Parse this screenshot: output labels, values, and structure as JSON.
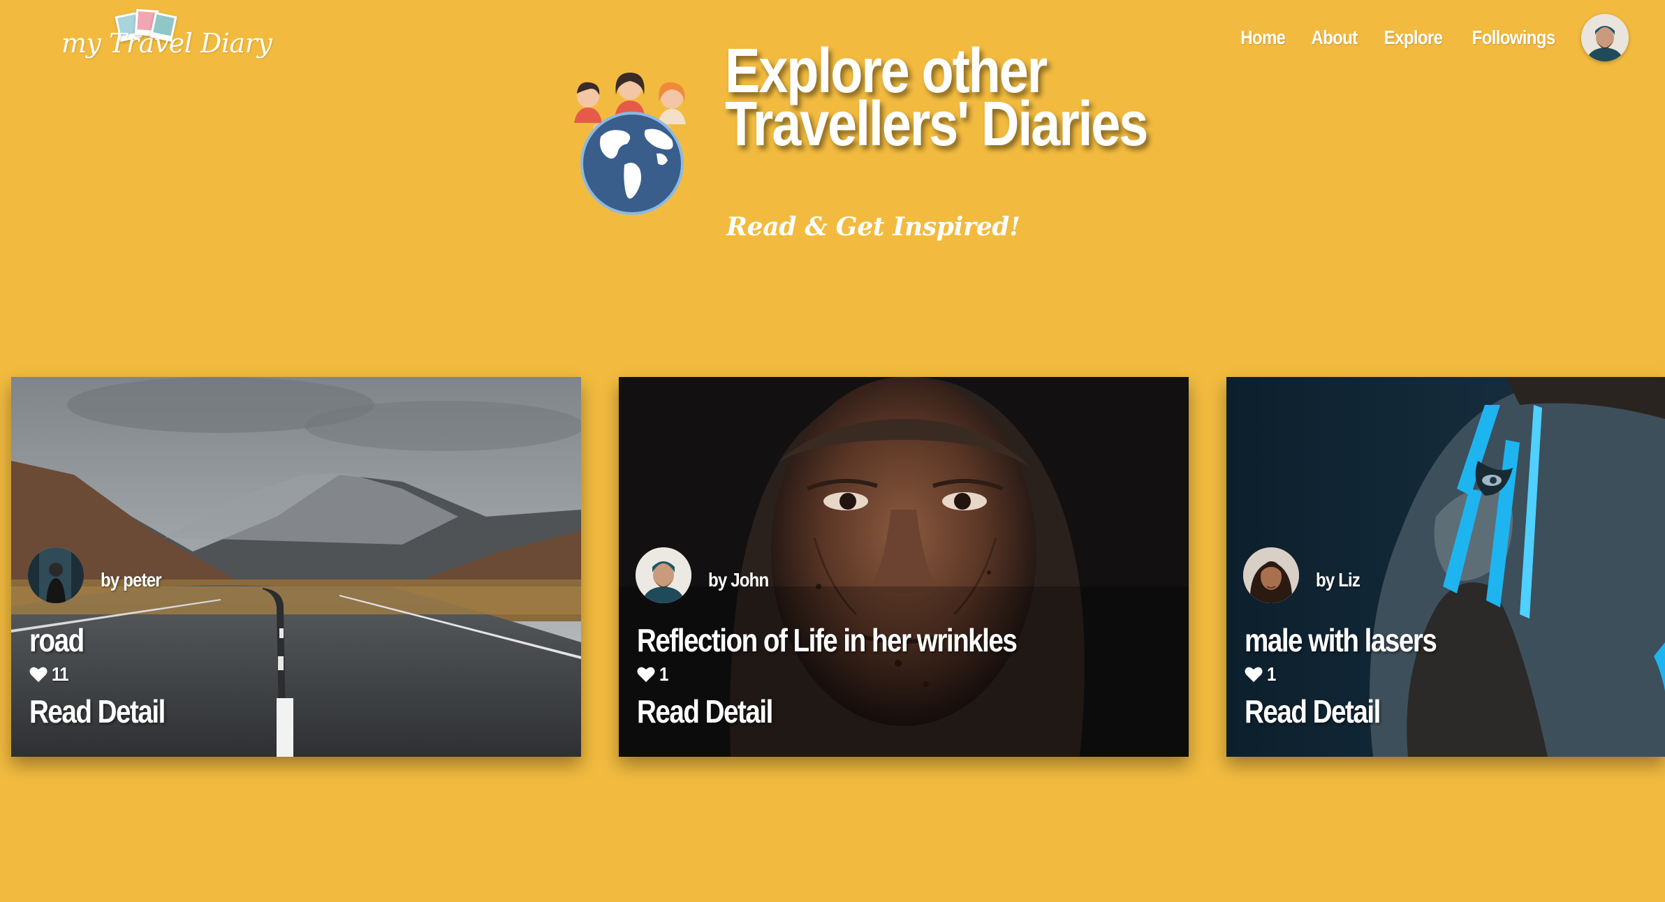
{
  "brand": {
    "logo_text": "my Travel Diary"
  },
  "nav": {
    "items": [
      {
        "label": "Home"
      },
      {
        "label": "About"
      },
      {
        "label": "Explore"
      },
      {
        "label": "Followings"
      }
    ],
    "avatar_icon": "user-avatar"
  },
  "hero": {
    "title_line1": "Explore other",
    "title_line2": "Travellers' Diaries",
    "subtitle": "Read & Get Inspired!",
    "illustration_icon": "travellers-globe"
  },
  "cards": [
    {
      "author": "by peter",
      "title": "road",
      "likes": "11",
      "cta": "Read Detail",
      "heart_icon": "heart-icon"
    },
    {
      "author": "by John",
      "title": "Reflection of Life in her wrinkles",
      "likes": "1",
      "cta": "Read Detail",
      "heart_icon": "heart-icon"
    },
    {
      "author": "by Liz",
      "title": "male with lasers",
      "likes": "1",
      "cta": "Read Detail",
      "heart_icon": "heart-icon"
    }
  ],
  "colors": {
    "background": "#F2BB3F",
    "text": "#FFFFFF",
    "globe": "#3A5E8C",
    "laser": "#1EB4F0"
  }
}
